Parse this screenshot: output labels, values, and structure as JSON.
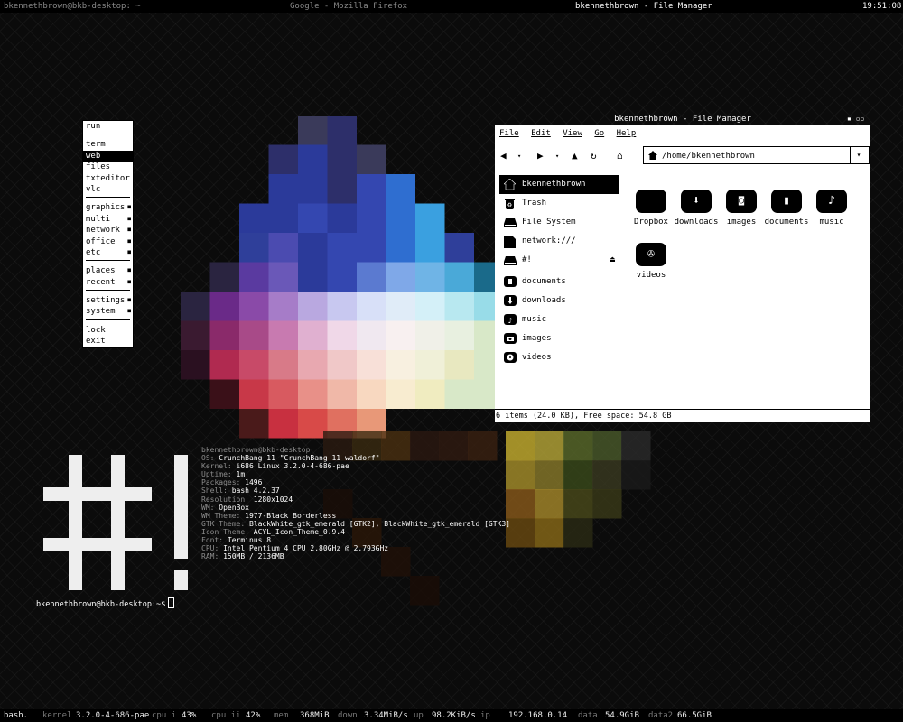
{
  "topbar": {
    "terminal_title": "bkennethbrown@bkb-desktop: ~",
    "firefox_title": "Google - Mozilla Firefox",
    "fm_title": "bkennethbrown - File Manager",
    "clock": "19:51:08"
  },
  "menu": {
    "items": [
      "run",
      "term",
      "web",
      "files",
      "txteditor",
      "vlc",
      "graphics",
      "multi",
      "network",
      "office",
      "etc",
      "places",
      "recent",
      "settings",
      "system",
      "lock",
      "exit"
    ]
  },
  "file_manager": {
    "window_title": "bkennethbrown - File Manager",
    "menubar": [
      "File",
      "Edit",
      "View",
      "Go",
      "Help"
    ],
    "address": "/home/bkennethbrown",
    "sidebar": [
      "bkennethbrown",
      "Trash",
      "File System",
      "network:///",
      "#!",
      "documents",
      "downloads",
      "music",
      "images",
      "videos"
    ],
    "folders": [
      "Dropbox",
      "downloads",
      "images",
      "documents",
      "music",
      "videos"
    ],
    "status": "6 items (24.0 KB), Free space: 54.8 GB"
  },
  "terminal": {
    "header": "bkennethbrown@bkb-desktop",
    "rows": [
      {
        "key": "OS:",
        "value": "CrunchBang 11 \"CrunchBang 11 waldorf\""
      },
      {
        "key": "Kernel:",
        "value": "i686 Linux 3.2.0-4-686-pae"
      },
      {
        "key": "Uptime:",
        "value": "1m"
      },
      {
        "key": "Packages:",
        "value": "1496"
      },
      {
        "key": "Shell:",
        "value": "bash 4.2.37"
      },
      {
        "key": "Resolution:",
        "value": "1280x1024"
      },
      {
        "key": "WM:",
        "value": "OpenBox"
      },
      {
        "key": "WM Theme:",
        "value": "1977-Black Borderless"
      },
      {
        "key": "GTK Theme:",
        "value": "BlackWhite_gtk_emerald [GTK2], BlackWhite_gtk_emerald [GTK3]"
      },
      {
        "key": "Icon Theme:",
        "value": "ACYL_Icon_Theme_0.9.4"
      },
      {
        "key": "Font:",
        "value": "Terminus 8"
      },
      {
        "key": "CPU:",
        "value": "Intel Pentium 4 CPU 2.80GHz @ 2.793GHz"
      },
      {
        "key": "RAM:",
        "value": "150MB / 2136MB"
      }
    ],
    "prompt": "bkennethbrown@bkb-desktop:~$"
  },
  "statusbar": {
    "app": "bash.",
    "kernel_label": "kernel",
    "kernel_value": "3.2.0-4-686-pae",
    "cpu1_label": "cpu i",
    "cpu1_value": "43%",
    "cpu2_label": "cpu ii",
    "cpu2_value": "42%",
    "mem_label": "mem",
    "mem_value": "368MiB",
    "down_label": "down",
    "down_value": "3.34MiB/s",
    "up_label": "up",
    "up_value": "98.2KiB/s",
    "ip_label": "ip",
    "ip_value": "192.168.0.14",
    "data_label": "data",
    "data_value": "54.9GiB",
    "data2_label": "data2",
    "data2_value": "66.5GiB"
  },
  "colors": {
    "accent": "#000000",
    "menu_bg": "#ffffff",
    "desktop_bg": "#0b0b0b"
  },
  "icons": [
    "house-icon",
    "trash-icon",
    "drive-icon",
    "network-icon",
    "eject-icon",
    "back-icon",
    "forward-icon",
    "up-icon",
    "reload-icon",
    "folder-icon"
  ]
}
